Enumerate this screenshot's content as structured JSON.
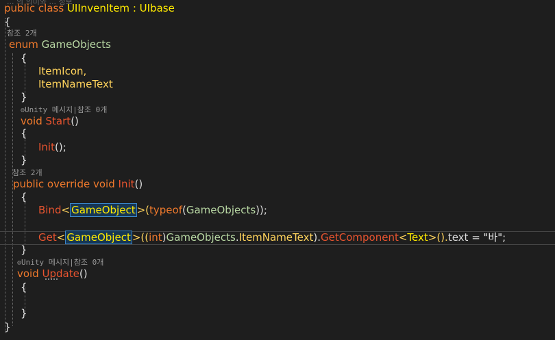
{
  "editor": {
    "header_fragment": "... 의 의미와 ... 정보",
    "class_decl": {
      "kw1": "public",
      "kw2": "class",
      "name": "UIInvenItem",
      "sep": " : ",
      "base": "UIbase"
    },
    "brace_open": "{",
    "brace_close": "}",
    "lens_refs_2": "참조 2개",
    "lens_unity_0": "Unity 메시지|참조 0개",
    "enum_decl": {
      "kw": "enum",
      "name": "GameObjects"
    },
    "enum_items": [
      "ItemIcon,",
      "ItemNameText"
    ],
    "start_decl": {
      "kw": "void",
      "name": "Start",
      "parens": "()"
    },
    "init_call": {
      "name": "Init",
      "rest": "();"
    },
    "init_decl": {
      "kw1": "public",
      "kw2": "override",
      "kw3": "void",
      "name": "Init",
      "parens": "()"
    },
    "bind_line": {
      "method": "Bind",
      "lt": "<",
      "type": "GameObject",
      "gt": ">(",
      "kw": "typeof",
      "open": "(",
      "arg": "GameObjects",
      "close": "));"
    },
    "get_line": {
      "method": "Get",
      "lt": "<",
      "type": "GameObject",
      "gt": ">((",
      "cast": "int",
      "close_cast": ")",
      "enum": "GameObjects",
      "dot1": ".",
      "member": "ItemNameText",
      "dot2": ").",
      "method2": "GetComponent",
      "lt2": "<",
      "type2": "Text",
      "gt2": ">().",
      "prop": "text",
      "assign": " = ",
      "str": "\"바\"",
      "end": ";"
    },
    "update_decl": {
      "kw": "void",
      "name": "Update",
      "parens": "()"
    }
  }
}
